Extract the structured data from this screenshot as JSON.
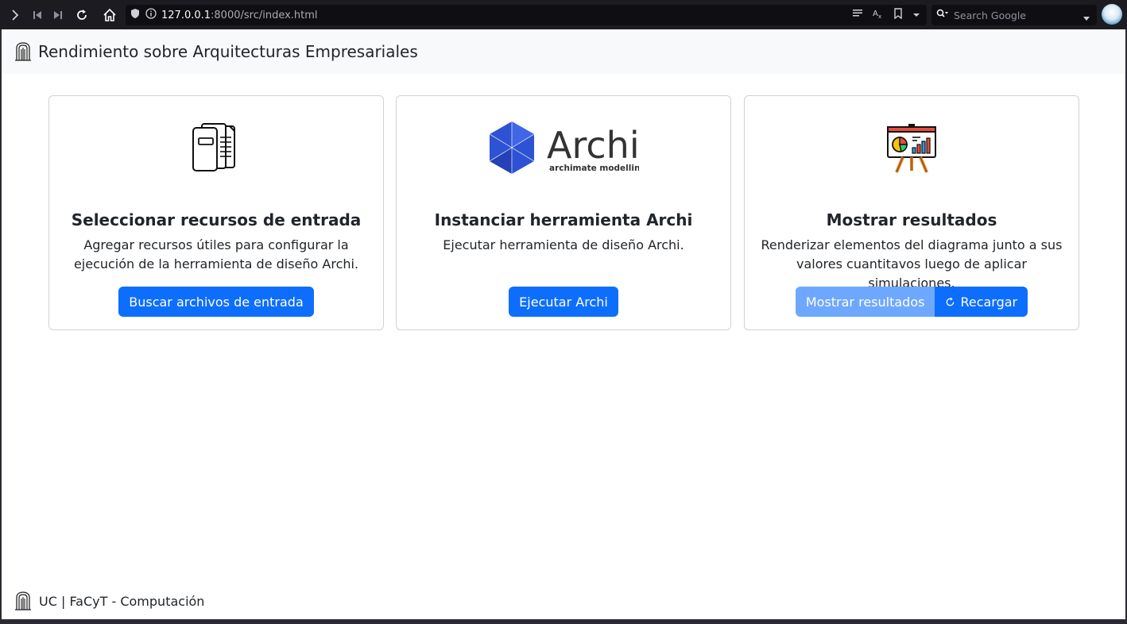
{
  "browser": {
    "url_host": "127.0.0.1",
    "url_rest": ":8000/src/index.html",
    "search_placeholder": "Search Google"
  },
  "navbar": {
    "title": "Rendimiento sobre Arquitecturas Empresariales"
  },
  "cards": [
    {
      "icon": "documents-icon",
      "title": "Seleccionar recursos de entrada",
      "text": "Agregar recursos útiles para configurar la ejecución de la herramienta de diseño Archi.",
      "button": "Buscar archivos de entrada"
    },
    {
      "icon": "archi-logo",
      "logo_word": "Archi",
      "logo_tagline": "archimate modelling",
      "title": "Instanciar herramienta Archi",
      "text": "Ejecutar herramienta de diseño Archi.",
      "button": "Ejecutar Archi"
    },
    {
      "icon": "presentation-chart-icon",
      "title": "Mostrar resultados",
      "text": "Renderizar elementos del diagrama junto a sus valores cuantitavos luego de aplicar simulaciones.",
      "button": "Mostrar resultados",
      "button2": "Recargar"
    }
  ],
  "footer": {
    "text": "UC | FaCyT - Computación"
  },
  "colors": {
    "primary": "#0d6efd",
    "primary_disabled": "#6ea8fe",
    "archi_blue": "#2e52d4"
  }
}
